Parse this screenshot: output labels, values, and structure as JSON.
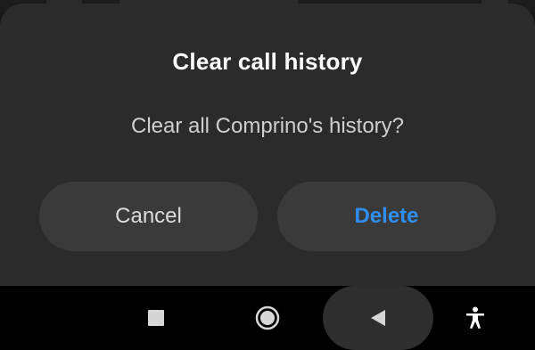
{
  "dialog": {
    "title": "Clear call history",
    "message": "Clear all Comprino's history?",
    "cancel_label": "Cancel",
    "delete_label": "Delete"
  },
  "navbar": {
    "recents_icon": "square-recents-icon",
    "home_icon": "circle-home-icon",
    "back_icon": "triangle-back-icon",
    "accessibility_icon": "accessibility-person-icon"
  },
  "colors": {
    "dialog_background": "#2b2b2b",
    "button_background": "#3a3a3a",
    "accent": "#2e8ff0",
    "navbar_background": "#000000"
  }
}
